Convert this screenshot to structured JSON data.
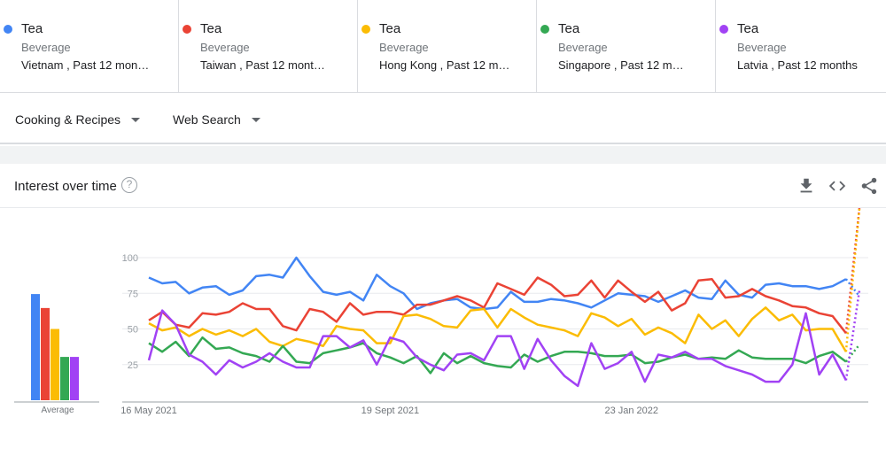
{
  "terms": [
    {
      "name": "Tea",
      "category": "Beverage",
      "scope": "Vietnam , Past 12 mon…",
      "color": "#4285f4"
    },
    {
      "name": "Tea",
      "category": "Beverage",
      "scope": "Taiwan , Past 12 mont…",
      "color": "#ea4335"
    },
    {
      "name": "Tea",
      "category": "Beverage",
      "scope": "Hong Kong , Past 12 m…",
      "color": "#fbbc04"
    },
    {
      "name": "Tea",
      "category": "Beverage",
      "scope": "Singapore , Past 12 m…",
      "color": "#34a853"
    },
    {
      "name": "Tea",
      "category": "Beverage",
      "scope": "Latvia , Past 12 months",
      "color": "#a142f4"
    }
  ],
  "filters": {
    "category": "Cooking & Recipes",
    "search_type": "Web Search"
  },
  "card": {
    "title": "Interest over time",
    "help": "?"
  },
  "icons": {
    "download": "download-icon",
    "embed": "embed-code-icon",
    "share": "share-icon"
  },
  "chart_data": {
    "type": "line",
    "title": "Interest over time",
    "ylim": [
      0,
      100
    ],
    "yticks": [
      25,
      50,
      75,
      100
    ],
    "xtick_labels": [
      {
        "week": 0,
        "label": "16 May 2021"
      },
      {
        "week": 18,
        "label": "19 Sept 2021"
      },
      {
        "week": 36,
        "label": "23 Jan 2022"
      }
    ],
    "grid": true,
    "average_label": "Average",
    "averages": [
      76,
      66,
      51,
      31,
      31
    ],
    "series": [
      {
        "name": "Tea (Vietnam)",
        "color": "#4285f4",
        "values": [
          86,
          82,
          83,
          75,
          79,
          80,
          74,
          77,
          87,
          88,
          86,
          100,
          87,
          76,
          74,
          76,
          70,
          88,
          80,
          75,
          64,
          68,
          70,
          71,
          65,
          64,
          65,
          76,
          69,
          69,
          71,
          70,
          68,
          65,
          70,
          75,
          74,
          73,
          69,
          73,
          77,
          72,
          71,
          84,
          74,
          72,
          81,
          82,
          80,
          80,
          78,
          80,
          85,
          73
        ]
      },
      {
        "name": "Tea (Taiwan)",
        "color": "#ea4335",
        "values": [
          56,
          62,
          53,
          51,
          61,
          60,
          62,
          68,
          64,
          64,
          52,
          49,
          64,
          62,
          55,
          68,
          60,
          62,
          62,
          60,
          67,
          67,
          70,
          73,
          70,
          65,
          82,
          78,
          74,
          86,
          81,
          73,
          74,
          84,
          72,
          84,
          76,
          69,
          76,
          63,
          68,
          84,
          85,
          72,
          73,
          78,
          73,
          70,
          66,
          65,
          61,
          59,
          47
        ]
      },
      {
        "name": "Tea (Hong Kong)",
        "color": "#fbbc04",
        "values": [
          54,
          49,
          51,
          45,
          50,
          46,
          49,
          45,
          50,
          41,
          38,
          43,
          41,
          38,
          52,
          50,
          49,
          40,
          40,
          59,
          60,
          57,
          52,
          51,
          63,
          64,
          51,
          64,
          58,
          53,
          51,
          49,
          45,
          61,
          58,
          52,
          57,
          46,
          51,
          47,
          40,
          60,
          50,
          56,
          45,
          57,
          65,
          56,
          60,
          49,
          50,
          50,
          34
        ]
      },
      {
        "name": "Tea (Singapore)",
        "color": "#34a853",
        "values": [
          40,
          34,
          41,
          31,
          44,
          36,
          37,
          33,
          31,
          27,
          38,
          27,
          26,
          33,
          35,
          37,
          40,
          33,
          30,
          26,
          31,
          19,
          33,
          26,
          31,
          26,
          24,
          23,
          32,
          27,
          31,
          34,
          34,
          33,
          31,
          31,
          32,
          26,
          27,
          30,
          32,
          29,
          30,
          29,
          35,
          30,
          29,
          29,
          29,
          26,
          31,
          34,
          27,
          39
        ]
      },
      {
        "name": "Tea (Latvia)",
        "color": "#a142f4",
        "values": [
          28,
          63,
          53,
          32,
          27,
          18,
          28,
          23,
          27,
          33,
          27,
          23,
          23,
          45,
          45,
          37,
          42,
          25,
          44,
          41,
          30,
          25,
          21,
          32,
          33,
          28,
          45,
          45,
          22,
          43,
          28,
          17,
          10,
          40,
          22,
          26,
          34,
          13,
          32,
          30,
          34,
          29,
          29,
          24,
          21,
          18,
          13,
          13,
          25,
          61,
          18,
          32,
          14,
          77
        ]
      }
    ]
  }
}
